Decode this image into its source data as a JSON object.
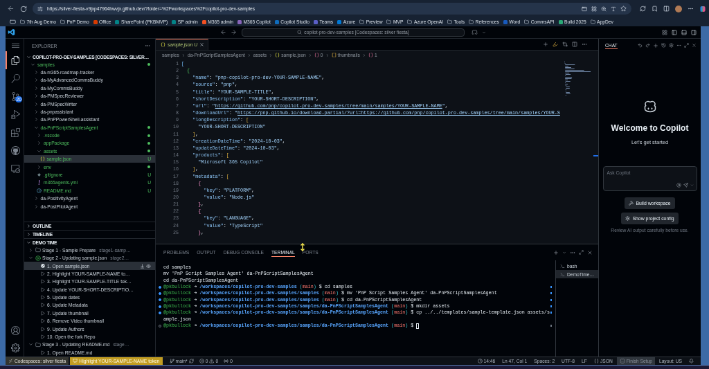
{
  "browser": {
    "url": "https://silver-fiesta-v9jxp47964hwvjx.github.dev/?folder=%2Fworkspaces%2Fcopilot-pro-dev-samples",
    "bookmarks": [
      {
        "label": "7th Aug Demo",
        "kind": "folder"
      },
      {
        "label": "PnP Demo",
        "kind": "folder"
      },
      {
        "label": "Office",
        "kind": "site",
        "color": "#d83b01"
      },
      {
        "label": "SharePoint (PKBMVP)",
        "kind": "site",
        "color": "#038387"
      },
      {
        "label": "SP admin",
        "kind": "site",
        "color": "#038387"
      },
      {
        "label": "M365 admin",
        "kind": "site",
        "color": "#f25022"
      },
      {
        "label": "M365 Copilot",
        "kind": "site",
        "color": "#8764b8"
      },
      {
        "label": "Copilot Studio",
        "kind": "site",
        "color": "#0f6cbd"
      },
      {
        "label": "Teams",
        "kind": "site",
        "color": "#5b5fc7"
      },
      {
        "label": "Azure",
        "kind": "site",
        "color": "#0078d4"
      },
      {
        "label": "Preview",
        "kind": "folder"
      },
      {
        "label": "MVP",
        "kind": "folder"
      },
      {
        "label": "Azure OpenAI",
        "kind": "folder"
      },
      {
        "label": "Tools",
        "kind": "folder"
      },
      {
        "label": "References",
        "kind": "folder"
      },
      {
        "label": "Word",
        "kind": "site",
        "color": "#185abd"
      },
      {
        "label": "CommsAPI",
        "kind": "folder"
      },
      {
        "label": "Build 2025",
        "kind": "site",
        "color": "#2aa876"
      },
      {
        "label": "AppDev",
        "kind": "folder"
      }
    ]
  },
  "titlebar": {
    "command_center": "copilot-pro-dev-samples [Codespaces: silver fiesta]"
  },
  "activity_bar": {
    "items": [
      {
        "kind": "explorer",
        "selected": true
      },
      {
        "kind": "search",
        "selected": false
      },
      {
        "kind": "source_control",
        "selected": false,
        "badge": "20"
      },
      {
        "kind": "run",
        "selected": false
      },
      {
        "kind": "extensions",
        "selected": false
      },
      {
        "kind": "github",
        "selected": false
      },
      {
        "kind": "remote",
        "selected": false
      }
    ]
  },
  "sidebar": {
    "title": "EXPLORER",
    "root": {
      "label": "COPILOT-PRO-DEV-SAMPLES [CODESPACES: SILVER…",
      "expanded": true
    },
    "tree": [
      {
        "label": "samples",
        "kind": "folder",
        "expanded": true,
        "selected": false,
        "untracked": true,
        "children": [
          {
            "label": "da-m365-roadmap-tracker",
            "kind": "folder",
            "expanded": false,
            "selected": false,
            "untracked": false
          },
          {
            "label": "da-MyAdvancedCommsBuddy",
            "kind": "folder",
            "expanded": false,
            "selected": false,
            "untracked": false
          },
          {
            "label": "da-MyCommsBuddy",
            "kind": "folder",
            "expanded": false,
            "selected": false,
            "untracked": false
          },
          {
            "label": "da-PMSpecReviewer",
            "kind": "folder",
            "expanded": false,
            "selected": false,
            "untracked": false
          },
          {
            "label": "da-PMSpecWriter",
            "kind": "folder",
            "expanded": false,
            "selected": false,
            "untracked": false
          },
          {
            "label": "da-pnpassistant",
            "kind": "folder",
            "expanded": false,
            "selected": false,
            "untracked": false
          },
          {
            "label": "da-PnPPowerShell-assistant",
            "kind": "folder",
            "expanded": false,
            "selected": false,
            "untracked": false
          },
          {
            "label": "da-PnPScriptSamplesAgent",
            "kind": "folder",
            "expanded": true,
            "selected": false,
            "untracked": true,
            "children": [
              {
                "label": ".vscode",
                "kind": "folder",
                "expanded": false,
                "selected": false,
                "untracked": true
              },
              {
                "label": "appPackage",
                "kind": "folder",
                "expanded": false,
                "selected": false,
                "untracked": true
              },
              {
                "label": "assets",
                "kind": "folder",
                "expanded": true,
                "selected": false,
                "untracked": true,
                "children": [
                  {
                    "label": "sample.json",
                    "kind": "json",
                    "selected": true,
                    "untracked": true,
                    "decoration": "U"
                  }
                ]
              },
              {
                "label": "env",
                "kind": "folder",
                "expanded": false,
                "selected": false,
                "untracked": true
              },
              {
                "label": ".gitignore",
                "kind": "gitignore",
                "selected": false,
                "untracked": true,
                "decoration": "U"
              },
              {
                "label": "m365agents.yml",
                "kind": "yaml",
                "selected": false,
                "untracked": true,
                "decoration": "U"
              },
              {
                "label": "README.md",
                "kind": "markdown",
                "selected": false,
                "untracked": true,
                "decoration": "U"
              }
            ]
          },
          {
            "label": "da-PositivityAgent",
            "kind": "folder",
            "expanded": false,
            "selected": false,
            "untracked": false
          },
          {
            "label": "da-PostPilotAgent",
            "kind": "folder",
            "expanded": false,
            "selected": false,
            "untracked": false
          }
        ]
      }
    ]
  },
  "outline": {
    "title": "OUTLINE",
    "expanded": false
  },
  "timeline": {
    "title": "TIMELINE",
    "expanded": false
  },
  "demo_time": {
    "title": "DEMO TIME",
    "expanded": true,
    "stages": [
      {
        "label": "Stage 1 - Sample Prepare",
        "description": "stage1-samp…",
        "active": false,
        "expanded": false,
        "selected": false
      },
      {
        "label": "Stage 2 - Updating sample.json",
        "description": "stage2…",
        "active": true,
        "expanded": true,
        "selected": false,
        "steps": [
          {
            "label": "1. Open sample.json",
            "completed": true,
            "selected": true
          },
          {
            "label": "2. Highlight YOUR-SAMPLE-NAME to…",
            "completed": false,
            "selected": false
          },
          {
            "label": "3. Highlight YOUR-SAMPLE-TITLE tok…",
            "completed": false,
            "selected": false
          },
          {
            "label": "4. Update YOUR-SHORT-DESCRIPTIO…",
            "completed": false,
            "selected": false
          },
          {
            "label": "5. Update dates",
            "completed": false,
            "selected": false
          },
          {
            "label": "6. Update Metadata",
            "completed": false,
            "selected": false
          },
          {
            "label": "7. Update thumbnail",
            "completed": false,
            "selected": false
          },
          {
            "label": "8. Remove Video thumbnail",
            "completed": false,
            "selected": false
          },
          {
            "label": "9. Update Authors",
            "completed": false,
            "selected": false
          },
          {
            "label": "10. Open the fork Repo",
            "completed": false,
            "selected": false
          }
        ]
      },
      {
        "label": "Stage 3 - Updating README.md",
        "description": "stage…",
        "active": false,
        "expanded": true,
        "selected": false,
        "steps": [
          {
            "label": "1. Open README.md",
            "completed": false,
            "selected": false
          }
        ]
      }
    ]
  },
  "editor": {
    "tabs": [
      {
        "label": "sample.json",
        "decoration": "U",
        "selected": true,
        "preview": true,
        "untracked": true
      }
    ],
    "breadcrumbs": [
      {
        "label": "samples",
        "kind": "folder"
      },
      {
        "label": "da-PnPScriptSamplesAgent",
        "kind": "folder"
      },
      {
        "label": "assets",
        "kind": "folder"
      },
      {
        "label": "sample.json",
        "kind": "json"
      },
      {
        "label": "0",
        "kind": "object"
      },
      {
        "label": "thumbnails",
        "kind": "array"
      },
      {
        "label": "1",
        "kind": "object"
      }
    ],
    "lines": [
      {
        "number": "1",
        "tokens": [
          {
            "kind": "bracket1",
            "text": "["
          }
        ]
      },
      {
        "number": "2",
        "tokens": [
          {
            "kind": "bracket2",
            "text": "  {"
          }
        ]
      },
      {
        "number": "3",
        "tokens": [
          {
            "kind": "key",
            "text": "    \"name\""
          },
          {
            "kind": "plain",
            "text": ": "
          },
          {
            "kind": "string",
            "text": "\"pnp-copilot-pro-dev-YOUR-SAMPLE-NAME\""
          },
          {
            "kind": "plain",
            "text": ","
          }
        ]
      },
      {
        "number": "4",
        "tokens": [
          {
            "kind": "key",
            "text": "    \"source\""
          },
          {
            "kind": "plain",
            "text": ": "
          },
          {
            "kind": "string",
            "text": "\"pnp\""
          },
          {
            "kind": "plain",
            "text": ","
          }
        ]
      },
      {
        "number": "5",
        "tokens": [
          {
            "kind": "key",
            "text": "    \"title\""
          },
          {
            "kind": "plain",
            "text": ": "
          },
          {
            "kind": "string",
            "text": "\"YOUR-SAMPLE-TITLE\""
          },
          {
            "kind": "plain",
            "text": ","
          }
        ]
      },
      {
        "number": "6",
        "tokens": [
          {
            "kind": "key",
            "text": "    \"shortDescription\""
          },
          {
            "kind": "plain",
            "text": ": "
          },
          {
            "kind": "string",
            "text": "\"YOUR-SHORT-DESCRIPTION\""
          },
          {
            "kind": "plain",
            "text": ","
          }
        ]
      },
      {
        "number": "7",
        "tokens": [
          {
            "kind": "key",
            "text": "    \"url\""
          },
          {
            "kind": "plain",
            "text": ": "
          },
          {
            "kind": "string",
            "text": "\""
          },
          {
            "kind": "link",
            "text": "https://github.com/pnp/copilot-pro-dev-samples/tree/main/samples/YOUR-SAMPLE-NAME"
          },
          {
            "kind": "string",
            "text": "\""
          },
          {
            "kind": "plain",
            "text": ","
          }
        ]
      },
      {
        "number": "8",
        "tokens": [
          {
            "kind": "key",
            "text": "    \"downloadUrl\""
          },
          {
            "kind": "plain",
            "text": ": "
          },
          {
            "kind": "string",
            "text": "\""
          },
          {
            "kind": "link",
            "text": "https://pnp.github.io/download-partial/?url=https://github.com/pnp/copilot-pro-dev-samples/tree/main/samples/YOUR-S"
          }
        ]
      },
      {
        "number": "9",
        "tokens": [
          {
            "kind": "key",
            "text": "    \"longDescription\""
          },
          {
            "kind": "plain",
            "text": ": "
          },
          {
            "kind": "bracket3",
            "text": "["
          }
        ]
      },
      {
        "number": "10",
        "tokens": [
          {
            "kind": "string",
            "text": "      \"YOUR-SHORT-DESCRIPTION\""
          }
        ]
      },
      {
        "number": "11",
        "tokens": [
          {
            "kind": "bracket3",
            "text": "    ]"
          },
          {
            "kind": "plain",
            "text": ","
          }
        ]
      },
      {
        "number": "12",
        "tokens": [
          {
            "kind": "key",
            "text": "    \"creationDateTime\""
          },
          {
            "kind": "plain",
            "text": ": "
          },
          {
            "kind": "string",
            "text": "\"2024-10-03\""
          },
          {
            "kind": "plain",
            "text": ","
          }
        ]
      },
      {
        "number": "13",
        "tokens": [
          {
            "kind": "key",
            "text": "    \"updateDateTime\""
          },
          {
            "kind": "plain",
            "text": ": "
          },
          {
            "kind": "string",
            "text": "\"2024-10-03\""
          },
          {
            "kind": "plain",
            "text": ","
          }
        ]
      },
      {
        "number": "14",
        "tokens": [
          {
            "kind": "key",
            "text": "    \"products\""
          },
          {
            "kind": "plain",
            "text": ": "
          },
          {
            "kind": "bracket3",
            "text": "["
          }
        ]
      },
      {
        "number": "15",
        "tokens": [
          {
            "kind": "string",
            "text": "      \"Microsoft 365 Copilot\""
          }
        ]
      },
      {
        "number": "16",
        "tokens": [
          {
            "kind": "bracket3",
            "text": "    ]"
          },
          {
            "kind": "plain",
            "text": ","
          }
        ]
      },
      {
        "number": "17",
        "tokens": [
          {
            "kind": "key",
            "text": "    \"metadata\""
          },
          {
            "kind": "plain",
            "text": ": "
          },
          {
            "kind": "bracket3",
            "text": "["
          }
        ]
      },
      {
        "number": "18",
        "tokens": [
          {
            "kind": "bracket4",
            "text": "      {"
          }
        ]
      },
      {
        "number": "19",
        "tokens": [
          {
            "kind": "key",
            "text": "        \"key\""
          },
          {
            "kind": "plain",
            "text": ": "
          },
          {
            "kind": "string",
            "text": "\"PLATFORM\""
          },
          {
            "kind": "plain",
            "text": ","
          }
        ]
      },
      {
        "number": "20",
        "tokens": [
          {
            "kind": "key",
            "text": "        \"value\""
          },
          {
            "kind": "plain",
            "text": ": "
          },
          {
            "kind": "string",
            "text": "\"Node.js\""
          }
        ]
      },
      {
        "number": "21",
        "tokens": [
          {
            "kind": "bracket4",
            "text": "      }"
          },
          {
            "kind": "plain",
            "text": ","
          }
        ]
      },
      {
        "number": "22",
        "tokens": [
          {
            "kind": "bracket4",
            "text": "      {"
          }
        ]
      },
      {
        "number": "23",
        "tokens": [
          {
            "kind": "key",
            "text": "        \"key\""
          },
          {
            "kind": "plain",
            "text": ": "
          },
          {
            "kind": "string",
            "text": "\"LANGUAGE\""
          },
          {
            "kind": "plain",
            "text": ","
          }
        ]
      },
      {
        "number": "24",
        "tokens": [
          {
            "kind": "key",
            "text": "        \"value\""
          },
          {
            "kind": "plain",
            "text": ": "
          },
          {
            "kind": "string",
            "text": "\"TypeScript\""
          }
        ]
      },
      {
        "number": "25",
        "tokens": [
          {
            "kind": "bracket4",
            "text": "      }"
          },
          {
            "kind": "plain",
            "text": ","
          }
        ]
      }
    ]
  },
  "panel": {
    "tabs": [
      {
        "label": "PROBLEMS",
        "selected": false
      },
      {
        "label": "OUTPUT",
        "selected": false
      },
      {
        "label": "DEBUG CONSOLE",
        "selected": false
      },
      {
        "label": "TERMINAL",
        "selected": true
      },
      {
        "label": "PORTS",
        "selected": false
      }
    ],
    "terminal": {
      "lines": [
        {
          "kind": "output",
          "text": "cd samples",
          "cursor": false
        },
        {
          "kind": "output",
          "text": "mv 'PnP Script Samples Agent' da-PnPScriptSamplesAgent",
          "cursor": false
        },
        {
          "kind": "output",
          "text": "cd da-PnPScriptSamplesAgent",
          "cursor": false
        },
        {
          "kind": "prompt",
          "succeeded": true,
          "cursor": false,
          "tokens": [
            {
              "kind": "user",
              "text": "@pkbullock"
            },
            {
              "kind": "plain",
              "text": " ➜ "
            },
            {
              "kind": "path",
              "text": "/workspaces/copilot-pro-dev-samples"
            },
            {
              "kind": "paren",
              "text": " ("
            },
            {
              "kind": "branch",
              "text": "main"
            },
            {
              "kind": "paren",
              "text": ")"
            },
            {
              "kind": "plain",
              "text": " $ cd samples"
            }
          ]
        },
        {
          "kind": "prompt",
          "succeeded": true,
          "cursor": false,
          "tokens": [
            {
              "kind": "user",
              "text": "@pkbullock"
            },
            {
              "kind": "plain",
              "text": " ➜ "
            },
            {
              "kind": "path",
              "text": "/workspaces/copilot-pro-dev-samples/samples"
            },
            {
              "kind": "paren",
              "text": " ("
            },
            {
              "kind": "branch",
              "text": "main"
            },
            {
              "kind": "paren",
              "text": ")"
            },
            {
              "kind": "plain",
              "text": " $ mv 'PnP Script Samples Agent' da-PnPScriptSamplesAgent"
            }
          ]
        },
        {
          "kind": "prompt",
          "succeeded": true,
          "cursor": false,
          "tokens": [
            {
              "kind": "user",
              "text": "@pkbullock"
            },
            {
              "kind": "plain",
              "text": " ➜ "
            },
            {
              "kind": "path",
              "text": "/workspaces/copilot-pro-dev-samples/samples"
            },
            {
              "kind": "paren",
              "text": " ("
            },
            {
              "kind": "branch",
              "text": "main"
            },
            {
              "kind": "paren",
              "text": ")"
            },
            {
              "kind": "plain",
              "text": " $ cd da-PnPScriptSamplesAgent"
            }
          ]
        },
        {
          "kind": "prompt",
          "succeeded": true,
          "cursor": false,
          "tokens": [
            {
              "kind": "user",
              "text": "@pkbullock"
            },
            {
              "kind": "plain",
              "text": " ➜ "
            },
            {
              "kind": "path",
              "text": "/workspaces/copilot-pro-dev-samples/samples/da-PnPScriptSamplesAgent"
            },
            {
              "kind": "paren",
              "text": " ("
            },
            {
              "kind": "branch",
              "text": "main"
            },
            {
              "kind": "paren",
              "text": ")"
            },
            {
              "kind": "plain",
              "text": " $ mkdir assets"
            }
          ]
        },
        {
          "kind": "prompt",
          "succeeded": true,
          "cursor": false,
          "tokens": [
            {
              "kind": "user",
              "text": "@pkbullock"
            },
            {
              "kind": "plain",
              "text": " ➜ "
            },
            {
              "kind": "path",
              "text": "/workspaces/copilot-pro-dev-samples/samples/da-PnPScriptSamplesAgent"
            },
            {
              "kind": "paren",
              "text": " ("
            },
            {
              "kind": "branch",
              "text": "main"
            },
            {
              "kind": "paren",
              "text": ")"
            },
            {
              "kind": "plain",
              "text": " $ cp ../../templates/sample-template.json assets/sample.json"
            }
          ]
        },
        {
          "kind": "prompt",
          "succeeded": false,
          "cursor": true,
          "tokens": [
            {
              "kind": "user",
              "text": "@pkbullock"
            },
            {
              "kind": "plain",
              "text": " ➜ "
            },
            {
              "kind": "path",
              "text": "/workspaces/copilot-pro-dev-samples/samples/da-PnPScriptSamplesAgent"
            },
            {
              "kind": "paren",
              "text": " ("
            },
            {
              "kind": "branch",
              "text": "main"
            },
            {
              "kind": "paren",
              "text": ")"
            },
            {
              "kind": "plain",
              "text": " $ "
            }
          ]
        }
      ]
    },
    "sessions": [
      {
        "label": "bash",
        "selected": false
      },
      {
        "label": "DemoTime…",
        "selected": true
      }
    ]
  },
  "chat": {
    "title": "CHAT",
    "heading": "Welcome to Copilot",
    "subheading": "Let's get started",
    "input": {
      "placeholder": "Ask Copilot"
    },
    "actions": [
      {
        "kind": "build",
        "label": "Build workspace"
      },
      {
        "kind": "config",
        "label": "Show project config"
      }
    ],
    "disclaimer": "Review AI output carefully before use."
  },
  "status_bar": {
    "remote": "Codespaces: silver fiesta",
    "demo_step": "Highlight YOUR-SAMPLE-NAME token",
    "branch": "main*",
    "errors": "0",
    "warnings": "0",
    "ports": "0",
    "items": [
      {
        "kind": "clock",
        "text": "14:46"
      },
      {
        "kind": "text",
        "text": "Ln 47, Col 1"
      },
      {
        "kind": "text",
        "text": "Spaces: 2"
      },
      {
        "kind": "text",
        "text": "UTF-8"
      },
      {
        "kind": "text",
        "text": "LF"
      },
      {
        "kind": "language",
        "text": "JSON"
      },
      {
        "kind": "setup",
        "text": "Finish Setup"
      },
      {
        "kind": "text",
        "text": "Layout: US"
      },
      {
        "kind": "bell"
      }
    ]
  }
}
